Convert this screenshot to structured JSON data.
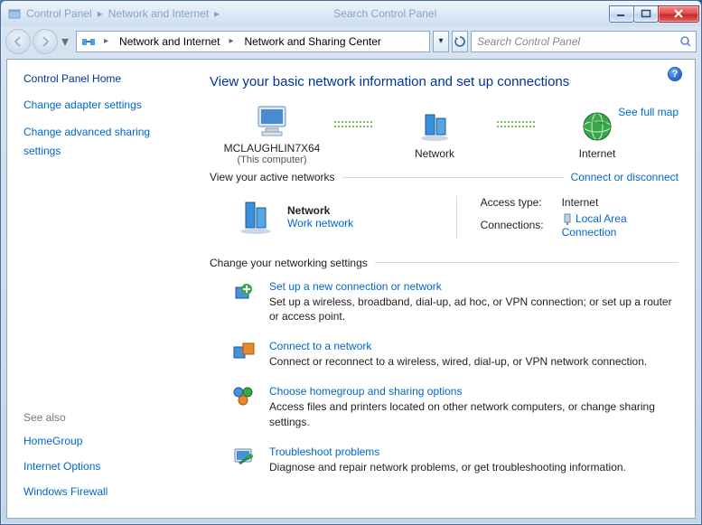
{
  "titlebar": {
    "title_hint_left": "Control Panel",
    "title_hint_mid": "Network and Internet",
    "search_hint": "Search Control Panel"
  },
  "breadcrumb": {
    "seg1": "Network and Internet",
    "seg2": "Network and Sharing Center"
  },
  "search": {
    "placeholder": "Search Control Panel"
  },
  "sidebar": {
    "home": "Control Panel Home",
    "link1": "Change adapter settings",
    "link2": "Change advanced sharing settings",
    "seealso_label": "See also",
    "sa1": "HomeGroup",
    "sa2": "Internet Options",
    "sa3": "Windows Firewall"
  },
  "main": {
    "heading": "View your basic network information and set up connections",
    "full_map": "See full map",
    "node1_name": "MCLAUGHLIN7X64",
    "node1_sub": "(This computer)",
    "node2_name": "Network",
    "node3_name": "Internet",
    "active_hdr": "View your active networks",
    "connect_toggle": "Connect or disconnect",
    "active_name": "Network",
    "active_type": "Work network",
    "access_label": "Access type:",
    "access_value": "Internet",
    "conn_label": "Connections:",
    "conn_value": "Local Area Connection",
    "change_hdr": "Change your networking settings",
    "task1_title": "Set up a new connection or network",
    "task1_desc": "Set up a wireless, broadband, dial-up, ad hoc, or VPN connection; or set up a router or access point.",
    "task2_title": "Connect to a network",
    "task2_desc": "Connect or reconnect to a wireless, wired, dial-up, or VPN network connection.",
    "task3_title": "Choose homegroup and sharing options",
    "task3_desc": "Access files and printers located on other network computers, or change sharing settings.",
    "task4_title": "Troubleshoot problems",
    "task4_desc": "Diagnose and repair network problems, or get troubleshooting information."
  }
}
